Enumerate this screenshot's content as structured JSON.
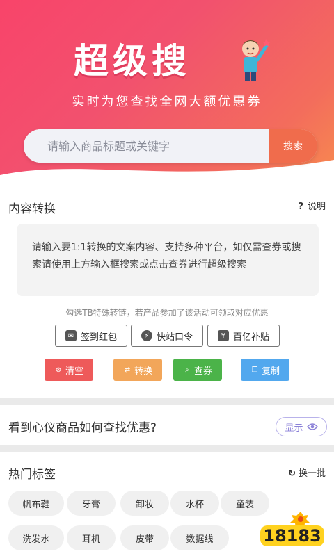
{
  "hero": {
    "logo": "超级搜",
    "slogan": "实时为您查找全网大额优惠券",
    "search_placeholder": "请输入商品标题或关键字",
    "search_button": "搜索"
  },
  "convert": {
    "title": "内容转换",
    "help": "说明",
    "help_icon": "?",
    "textarea_text": "请输入要1:1转换的文案内容、支持多种平台，如仅需查券或搜索请使用上方输入框搜索或点击查券进行超级搜索",
    "hint": "勾选TB特殊转链，若产品参加了该活动可领取对应优惠",
    "options": [
      {
        "label": "签到红包",
        "icon": "envelope-icon"
      },
      {
        "label": "快站口令",
        "icon": "lightning-icon"
      },
      {
        "label": "百亿补贴",
        "icon": "coupon-icon"
      }
    ],
    "actions": [
      {
        "label": "清空",
        "color": "#ee5a5a",
        "icon": "clear-icon"
      },
      {
        "label": "转换",
        "color": "#f2a65a",
        "icon": "convert-icon"
      },
      {
        "label": "查券",
        "color": "#4bb349",
        "icon": "coupon-search-icon"
      },
      {
        "label": "复制",
        "color": "#52a8ee",
        "icon": "copy-icon"
      }
    ]
  },
  "guide": {
    "title": "看到心仪商品如何查找优惠?",
    "show_button": "显示"
  },
  "hot_tags": {
    "title": "热门标签",
    "refresh": "换一批",
    "tags": [
      "帆布鞋",
      "牙膏",
      "卸妆",
      "水杯",
      "童装",
      "洗发水",
      "耳机",
      "皮带",
      "数据线"
    ]
  },
  "watermark": "18183",
  "colors": {
    "hero_start": "#f8446a",
    "hero_end": "#f78a4f",
    "search_button": "#f06c4c",
    "show_button": "#8c82d8"
  }
}
